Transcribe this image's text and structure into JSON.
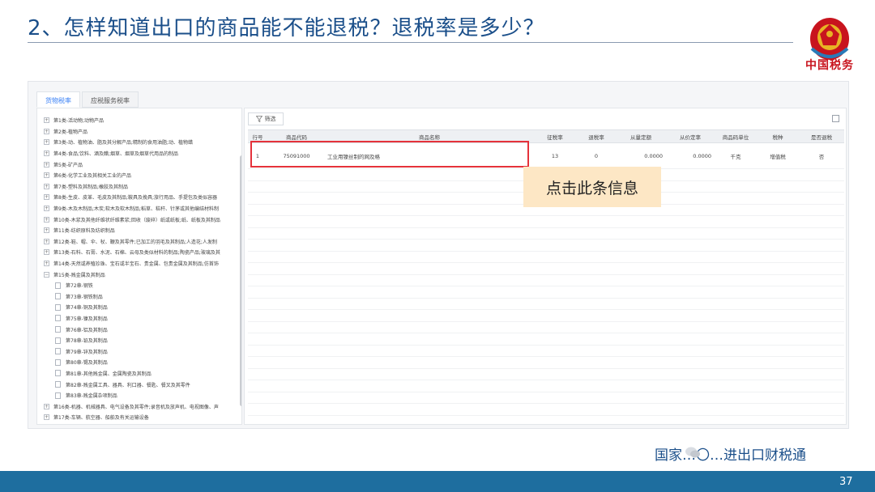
{
  "slide": {
    "title": "2、怎样知道出口的商品能不能退税？退税率是多少？",
    "logo_text": "中国税务",
    "footer_text": "国家…〇…进出口财税通",
    "page_number": "37"
  },
  "app": {
    "tabs": [
      {
        "label": "货物税率",
        "active": true
      },
      {
        "label": "应税服务税率",
        "active": false
      }
    ],
    "tree": [
      {
        "label": "第1类-活动物;动物产品",
        "expander": "+",
        "level": 0
      },
      {
        "label": "第2类-植物产品",
        "expander": "+",
        "level": 0
      },
      {
        "label": "第3类-动、植物油、脂及其分解产品;精制的食用油脂;动、植物蜡",
        "expander": "+",
        "level": 0
      },
      {
        "label": "第4类-食品;饮料、酒及醋;烟草、烟草及烟草代用品的制品",
        "expander": "+",
        "level": 0
      },
      {
        "label": "第5类-矿产品",
        "expander": "+",
        "level": 0
      },
      {
        "label": "第6类-化学工业及其相关工业的产品",
        "expander": "+",
        "level": 0
      },
      {
        "label": "第7类-塑料及其制品;橡胶及其制品",
        "expander": "+",
        "level": 0
      },
      {
        "label": "第8类-生皮、皮革、毛皮及其制品;鞍具及挽具;旅行用品、手提包及类似容器",
        "expander": "+",
        "level": 0
      },
      {
        "label": "第9类-木及木制品;木炭;软木及软木制品;稻草、秸秆、针茅或其他编结材料制",
        "expander": "+",
        "level": 0
      },
      {
        "label": "第10类-木浆及其他纤维状纤维素浆;回收（废碎）纸或纸板;纸、纸板及其制品",
        "expander": "+",
        "level": 0
      },
      {
        "label": "第11类-纺织原料及纺织制品",
        "expander": "+",
        "level": 0
      },
      {
        "label": "第12类-鞋、帽、伞、杖、鞭及其零件;已加工的羽毛及其制品;人造花;人发制",
        "expander": "+",
        "level": 0
      },
      {
        "label": "第13类-石料、石膏、水泥、石棉、云母及类似材料的制品;陶瓷产品;玻璃及其",
        "expander": "+",
        "level": 0
      },
      {
        "label": "第14类-天然或养殖珍珠、宝石或半宝石、贵金属、包贵金属及其制品;仿首饰",
        "expander": "+",
        "level": 0
      },
      {
        "label": "第15类-贱金属及其制品",
        "expander": "−",
        "level": 0
      },
      {
        "label": "第72章-钢铁",
        "level": 1
      },
      {
        "label": "第73章-钢铁制品",
        "level": 1
      },
      {
        "label": "第74章-铜及其制品",
        "level": 1
      },
      {
        "label": "第75章-镍及其制品",
        "level": 1
      },
      {
        "label": "第76章-铝及其制品",
        "level": 1
      },
      {
        "label": "第78章-铅及其制品",
        "level": 1
      },
      {
        "label": "第79章-锌及其制品",
        "level": 1
      },
      {
        "label": "第80章-锡及其制品",
        "level": 1
      },
      {
        "label": "第81章-其他贱金属、金属陶瓷及其制品",
        "level": 1
      },
      {
        "label": "第82章-贱金属工具、器具、利口器、餐匙、餐叉及其零件",
        "level": 1
      },
      {
        "label": "第83章-贱金属杂项制品",
        "level": 1
      },
      {
        "label": "第16类-机器、机械器具、电气设备及其零件;录音机及放声机、电视图像、声",
        "expander": "+",
        "level": 0
      },
      {
        "label": "第17类-车辆、航空器、船舶及有关运输设备",
        "expander": "+",
        "level": 0
      }
    ],
    "filter_label": "筛选",
    "table": {
      "headers": [
        "行号",
        "商品代码",
        "商品名称",
        "征税率",
        "退税率",
        "从量定额",
        "从价定率",
        "商品码单位",
        "税种",
        "是否退税"
      ],
      "rows": [
        [
          "1",
          "75091000",
          "工业用镍丝制的网及格",
          "13",
          "0",
          "0.0000",
          "0.0000",
          "千克",
          "增值税",
          "否"
        ]
      ]
    },
    "callout": "点击此条信息"
  },
  "colors": {
    "title": "#1b4f8a",
    "footer_bar": "#1e6e9f",
    "highlight_border": "#e5323b",
    "callout_bg": "#fde7c5",
    "logo_red": "#c8141e"
  }
}
